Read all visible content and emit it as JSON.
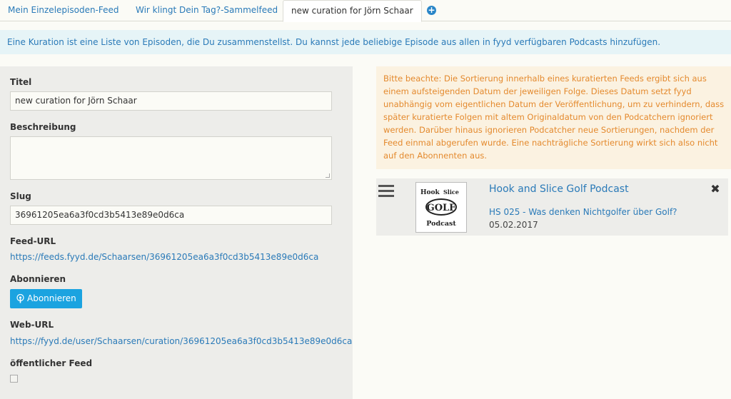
{
  "tabs": [
    {
      "label": "Mein Einzelepisoden-Feed"
    },
    {
      "label": "Wir klingt Dein Tag?-Sammelfeed"
    },
    {
      "label": "new curation for Jörn Schaar"
    }
  ],
  "add_tab_icon": "plus-circle-icon",
  "info_text": "Eine Kuration ist eine Liste von Episoden, die Du zusammenstellst. Du kannst jede beliebige Episode aus allen in fyyd verfügbaren Podcasts hinzufügen.",
  "form": {
    "title_label": "Titel",
    "title_value": "new curation for Jörn Schaar",
    "description_label": "Beschreibung",
    "description_value": "",
    "slug_label": "Slug",
    "slug_value": "36961205ea6a3f0cd3b5413e89e0d6ca",
    "feed_url_label": "Feed-URL",
    "feed_url": "https://feeds.fyyd.de/Schaarsen/36961205ea6a3f0cd3b5413e89e0d6ca",
    "subscribe_label": "Abonnieren",
    "subscribe_button": "Abonnieren",
    "web_url_label": "Web-URL",
    "web_url": "https://fyyd.de/user/Schaarsen/curation/36961205ea6a3f0cd3b5413e89e0d6ca",
    "public_feed_label": "öffentlicher Feed",
    "public_feed_checked": false
  },
  "warning_text": "Bitte beachte: Die Sortierung innerhalb eines kuratierten Feeds ergibt sich aus einem aufsteigenden Datum der jeweiligen Folge. Dieses Datum setzt fyyd unabhängig vom eigentlichen Datum der Veröffentlichung, um zu verhindern, dass später kuratierte Folgen mit altem Originaldatum von den Podcatchern ignoriert werden. Darüber hinaus ignorieren Podcatcher neue Sortierungen, nachdem der Feed einmal abgerufen wurde. Eine nachträgliche Sortierung wirkt sich also nicht auf den Abonnenten aus.",
  "episodes": [
    {
      "podcast": "Hook and Slice Golf Podcast",
      "title": "HS 025 - Was denken Nichtgolfer über Golf?",
      "date": "05.02.2017",
      "cover_text": [
        "Hook",
        "Slice",
        "GOLF",
        "Podcast"
      ]
    }
  ],
  "icons": {
    "drag": "drag-handle-icon",
    "remove": "close-icon",
    "subscribe": "podcast-icon"
  },
  "colors": {
    "link": "#2a7ab8",
    "button": "#1ba3e0",
    "warning_text": "#e48a2e",
    "warning_bg": "#fbf2e1",
    "info_bg": "#e6f4f7"
  }
}
